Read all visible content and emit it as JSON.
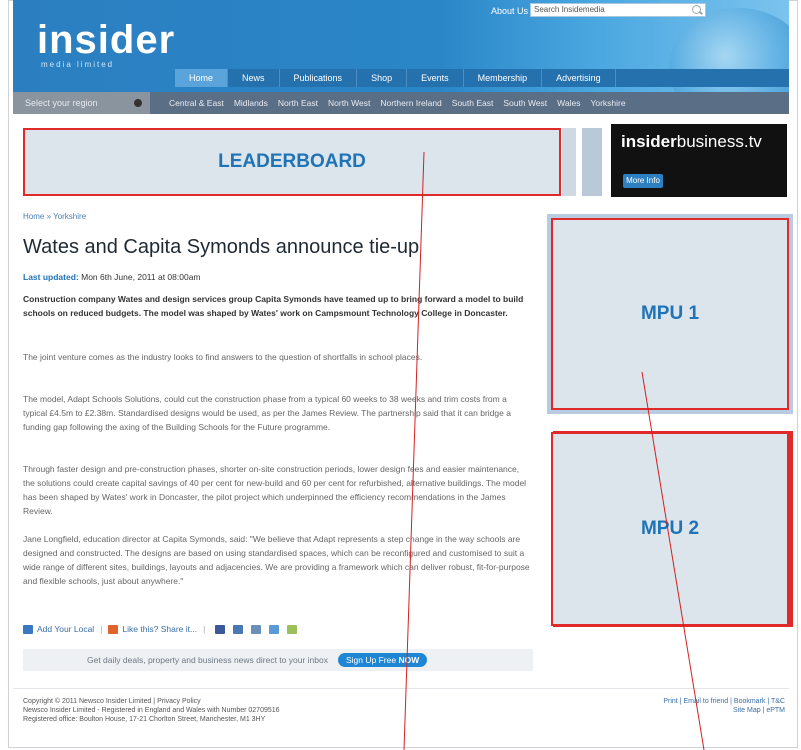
{
  "header": {
    "logo": "insider",
    "logo_sub": "media limited",
    "about_link": "About Us",
    "search_placeholder": "Search Insidemedia"
  },
  "main_nav": [
    "Home",
    "News",
    "Publications",
    "Shop",
    "Events",
    "Membership",
    "Advertising"
  ],
  "region_bar": {
    "select_label": "Select your region",
    "regions": [
      "Central & East",
      "Midlands",
      "North East",
      "North West",
      "Northern Ireland",
      "South East",
      "South West",
      "Wales",
      "Yorkshire"
    ]
  },
  "ads": {
    "leaderboard": "LEADERBOARD",
    "mpu1": "MPU 1",
    "mpu2": "MPU 2",
    "ibtv_bold": "insider",
    "ibtv_light": "business.tv",
    "ibtv_button": "More Info"
  },
  "article": {
    "breadcrumb": "Home » Yorkshire",
    "title": "Wates and Capita Symonds announce tie-up",
    "updated_label": "Last updated:",
    "updated_value": "Mon 6th June, 2011 at 08:00am",
    "lead": "Construction company Wates and design services group Capita Symonds have teamed up to bring forward a model to build schools on reduced budgets. The model was shaped by Wates' work on Campsmount Technology College in Doncaster.",
    "paragraphs": [
      "The joint venture comes as the industry looks to find answers to the question of shortfalls in school places.",
      "The model, Adapt Schools Solutions, could cut the construction phase from a typical 60 weeks to 38 weeks and trim costs from a typical £4.5m to £2.38m. Standardised designs would be used, as per the James Review. The partnership said that it can bridge a funding gap following the axing of the Building Schools for the Future programme.",
      "Through faster design and pre-construction phases, shorter on-site construction periods, lower design fees and easier maintenance, the solutions could create capital savings of 40 per cent for new-build and 60 per cent for refurbished, alternative buildings. The model has been shaped by Wates' work in Doncaster, the pilot project which underpinned the efficiency recommendations in the James Review.",
      "Jane Longfield, education director at Capita Symonds, said: \"We believe that Adapt represents a step change in the way schools are designed and constructed. The designs are based on using standardised spaces, which can be reconfigured and customised to suit a wide range of different sites, buildings, layouts and adjacencies. We are providing a framework which can deliver robust, fit-for-purpose and flexible schools, just about anywhere.\""
    ],
    "share_add": "Add Your Local",
    "share_like": "Like this? Share it..."
  },
  "newsletter": {
    "text": "Get daily deals, property and business news direct to your inbox",
    "button_prefix": "Sign Up Free",
    "button_bold": "NOW"
  },
  "footer": {
    "copyright": "Copyright © 2011 Newsco Insider Limited | Privacy Policy",
    "registered": "Newsco Insider Limited - Registered in England and Wales with Number 02709516",
    "office": "Registered office: Boulton House, 17-21 Chorlton Street, Manchester, M1 3HY",
    "right_links_1": "Print | Email to friend | Bookmark | T&C",
    "right_links_2": "Site Map | ePTM"
  },
  "colors": {
    "brand_blue": "#2a86c7",
    "ad_border_red": "#e02a2a",
    "ad_fill": "#dce4ec"
  }
}
